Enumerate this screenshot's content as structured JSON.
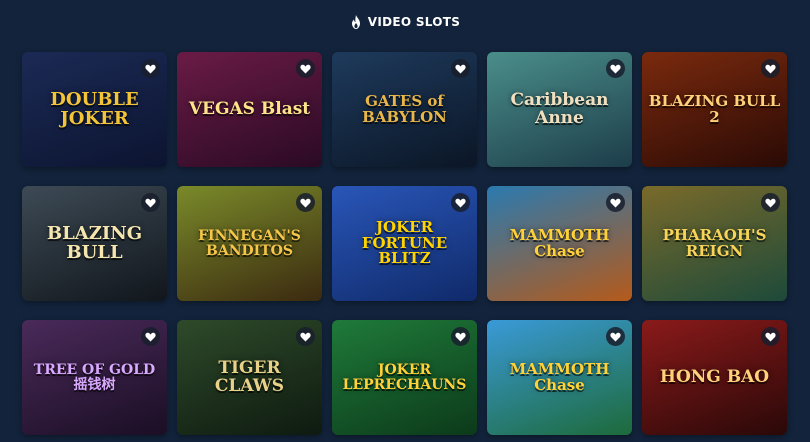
{
  "header": {
    "title": "VIDEO SLOTS",
    "icon": "flame-icon"
  },
  "games": [
    {
      "title": "DOUBLE JOKER",
      "bg": "linear-gradient(160deg,#1b2a55 0%,#0c1430 100%)",
      "color": "#f3c338",
      "size": "18px"
    },
    {
      "title": "VEGAS Blast",
      "bg": "linear-gradient(160deg,#6a1b46 0%,#2a0a24 100%)",
      "color": "#ffe38a",
      "size": "17px"
    },
    {
      "title": "GATES of BABYLON",
      "bg": "linear-gradient(160deg,#1e3a5c 0%,#0b1626 100%)",
      "color": "#e9b64a",
      "size": "15px"
    },
    {
      "title": "Caribbean Anne",
      "bg": "linear-gradient(160deg,#4a8e8a 0%,#1d3d4a 100%)",
      "color": "#f0e0c0",
      "size": "17px"
    },
    {
      "title": "BLAZING BULL 2",
      "bg": "linear-gradient(160deg,#7a2a0e 0%,#2a0a05 100%)",
      "color": "#ffd17a",
      "size": "15px"
    },
    {
      "title": "BLAZING BULL",
      "bg": "linear-gradient(160deg,#3d4a55 0%,#11161c 100%)",
      "color": "#f5e6b0",
      "size": "18px"
    },
    {
      "title": "FINNEGAN'S BANDITOS",
      "bg": "linear-gradient(160deg,#7a8a2a 0%,#3b2a10 100%)",
      "color": "#f4c64a",
      "size": "14px"
    },
    {
      "title": "JOKER FORTUNE BLITZ",
      "bg": "linear-gradient(160deg,#2956b8 0%,#102a6a 100%)",
      "color": "#ffd400",
      "size": "15px"
    },
    {
      "title": "MAMMOTH Chase",
      "bg": "linear-gradient(160deg,#2a7ab0 0%,#b55a1a 100%)",
      "color": "#ffd23a",
      "size": "15px"
    },
    {
      "title": "PHARAOH'S REIGN",
      "bg": "linear-gradient(160deg,#7a6a2a 0%,#1d4a3a 100%)",
      "color": "#f7d35a",
      "size": "15px"
    },
    {
      "title": "TREE OF GOLD 摇钱树",
      "bg": "linear-gradient(160deg,#4a2a5a 0%,#1a0e24 100%)",
      "color": "#d9a8ff",
      "size": "14px"
    },
    {
      "title": "TIGER CLAWS",
      "bg": "linear-gradient(160deg,#2e4a2a 0%,#0e1a10 100%)",
      "color": "#e8d28a",
      "size": "17px"
    },
    {
      "title": "JOKER LEPRECHAUNS",
      "bg": "linear-gradient(160deg,#1f7a3a 0%,#0c3a1a 100%)",
      "color": "#ffd23a",
      "size": "14px"
    },
    {
      "title": "MAMMOTH Chase",
      "bg": "linear-gradient(160deg,#3a9ad8 0%,#1d6a3a 100%)",
      "color": "#ffd23a",
      "size": "15px"
    },
    {
      "title": "HONG BAO",
      "bg": "linear-gradient(160deg,#8a1a1a 0%,#2a0808 100%)",
      "color": "#ffd27a",
      "size": "17px"
    }
  ],
  "favorite_icon": "heart-icon"
}
